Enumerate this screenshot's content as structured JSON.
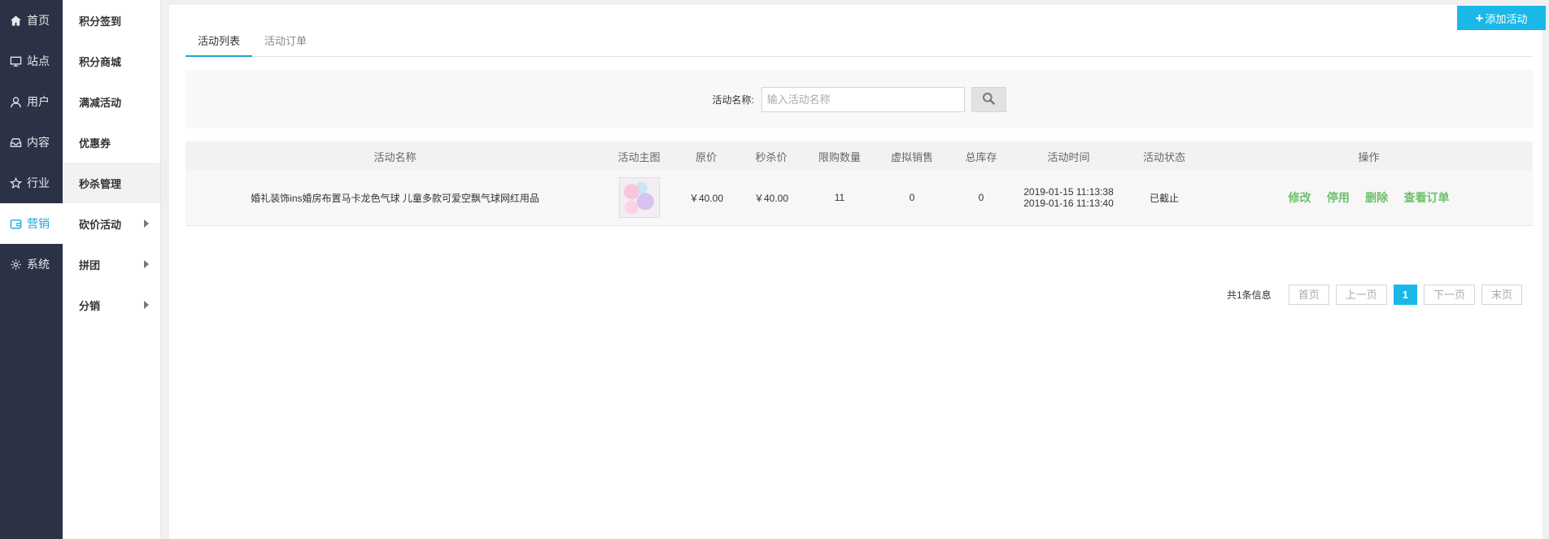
{
  "primary_nav": [
    {
      "label": "首页",
      "icon": "home-icon"
    },
    {
      "label": "站点",
      "icon": "monitor-icon"
    },
    {
      "label": "用户",
      "icon": "user-icon"
    },
    {
      "label": "内容",
      "icon": "inbox-icon"
    },
    {
      "label": "行业",
      "icon": "star-icon"
    },
    {
      "label": "营销",
      "icon": "wallet-icon",
      "active": true
    },
    {
      "label": "系统",
      "icon": "gear-icon"
    }
  ],
  "secondary_nav": [
    {
      "label": "积分签到"
    },
    {
      "label": "积分商城"
    },
    {
      "label": "满减活动"
    },
    {
      "label": "优惠券"
    },
    {
      "label": "秒杀管理",
      "active": true
    },
    {
      "label": "砍价活动",
      "submenu": true
    },
    {
      "label": "拼团",
      "submenu": true
    },
    {
      "label": "分销",
      "submenu": true
    }
  ],
  "toolbar": {
    "add_label": "添加活动"
  },
  "tabs": [
    {
      "label": "活动列表",
      "active": true
    },
    {
      "label": "活动订单"
    }
  ],
  "search": {
    "label": "活动名称:",
    "placeholder": "输入活动名称",
    "value": ""
  },
  "table": {
    "headers": [
      "活动名称",
      "活动主图",
      "原价",
      "秒杀价",
      "限购数量",
      "虚拟销售",
      "总库存",
      "活动时间",
      "活动状态",
      "操作"
    ],
    "rows": [
      {
        "name": "婚礼装饰ins婚房布置马卡龙色气球 儿童多款可爱空飘气球网红用品",
        "original_price": "￥40.00",
        "seckill_price": "￥40.00",
        "limit": "11",
        "virtual_sales": "0",
        "stock": "0",
        "start_time": "2019-01-15 11:13:38",
        "end_time": "2019-01-16 11:13:40",
        "status": "已截止",
        "actions": [
          "修改",
          "停用",
          "删除",
          "查看订单"
        ]
      }
    ]
  },
  "pagination": {
    "total": "共1条信息",
    "first": "首页",
    "prev": "上一页",
    "current": "1",
    "next": "下一页",
    "last": "末页"
  },
  "colors": {
    "accent": "#1ab8e8",
    "sidebar": "#2b3245",
    "action": "#6cc06c"
  }
}
